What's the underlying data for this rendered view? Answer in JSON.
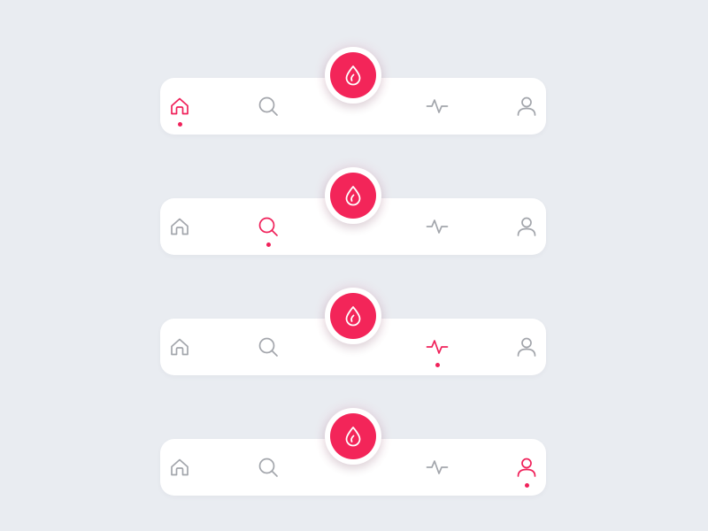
{
  "colors": {
    "background": "#e9ecf1",
    "bar": "#ffffff",
    "accent": "#f0215a",
    "icon_inactive": "#a3a6ac"
  },
  "center_button": {
    "icon": "drop-icon"
  },
  "tabs": [
    {
      "key": "home",
      "icon": "home-icon"
    },
    {
      "key": "search",
      "icon": "search-icon"
    },
    {
      "key": "activity",
      "icon": "activity-icon"
    },
    {
      "key": "profile",
      "icon": "user-icon"
    }
  ],
  "variants": [
    {
      "active_tab": "home"
    },
    {
      "active_tab": "search"
    },
    {
      "active_tab": "activity"
    },
    {
      "active_tab": "profile"
    }
  ]
}
